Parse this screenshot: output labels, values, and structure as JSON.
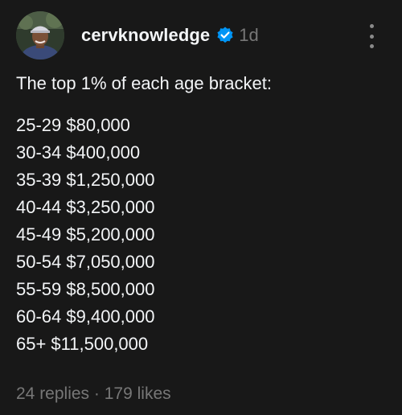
{
  "post": {
    "username": "cervknowledge",
    "verified": true,
    "timestamp": "1d",
    "intro": "The top 1% of each age bracket:",
    "brackets": [
      "25-29 $80,000",
      "30-34 $400,000",
      "35-39 $1,250,000",
      "40-44 $3,250,000",
      "45-49 $5,200,000",
      "50-54 $7,050,000",
      "55-59 $8,500,000",
      "60-64 $9,400,000",
      "65+ $11,500,000"
    ],
    "replies": "24 replies",
    "separator": "·",
    "likes": "179 likes"
  },
  "icons": {
    "verified": "verified-badge-icon",
    "more": "more-options-icon",
    "avatar": "profile-avatar"
  },
  "colors": {
    "background": "#181818",
    "text": "#f3f5f7",
    "muted": "#777777",
    "verified": "#0095f6"
  }
}
